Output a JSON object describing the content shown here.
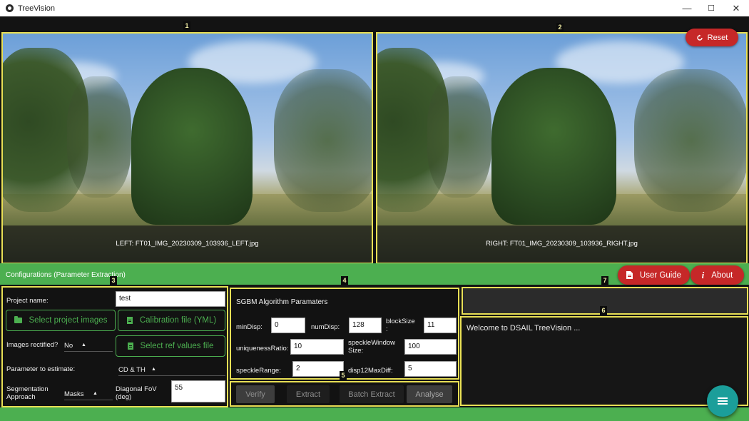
{
  "window": {
    "title": "TreeVision",
    "controls": {
      "minimize": "—",
      "maximize": "☐",
      "close": "✕"
    }
  },
  "markers": [
    "1",
    "2",
    "3",
    "4",
    "5",
    "6",
    "7"
  ],
  "images": {
    "left_caption": "LEFT: FT01_IMG_20230309_103936_LEFT.jpg",
    "right_caption": "RIGHT: FT01_IMG_20230309_103936_RIGHT.jpg"
  },
  "reset_label": "Reset",
  "band": {
    "title": "Configurations (Parameter Extraction)"
  },
  "header_buttons": {
    "user_guide": "User Guide",
    "about": "About"
  },
  "config": {
    "project_name_label": "Project name:",
    "project_name_value": "test",
    "select_images": "Select project images",
    "calibration_file": "Calibration file (YML)",
    "rectified_label": "Images rectified?",
    "rectified_value": "No",
    "select_ref": "Select ref values file",
    "param_label": "Parameter to estimate:",
    "param_value": "CD & TH",
    "segmentation_label_1": "Segmentation",
    "segmentation_label_2": "Approach",
    "segmentation_value": "Masks",
    "fov_label_1": "Diagonal FoV",
    "fov_label_2": "(deg)",
    "fov_value": "55"
  },
  "sgbm": {
    "title": "SGBM Algorithm Paramaters",
    "minDisp_label": "minDisp:",
    "minDisp": "0",
    "numDisp_label": "numDisp:",
    "numDisp": "128",
    "blockSize_label_1": "blockSize",
    "blockSize_label_2": ":",
    "blockSize": "11",
    "uniquenessRatio_label": "uniquenessRatio:",
    "uniquenessRatio": "10",
    "speckleWindow_label_1": "speckleWindow",
    "speckleWindow_label_2": "Size:",
    "speckleWindowSize": "100",
    "speckleRange_label": "speckleRange:",
    "speckleRange": "2",
    "disp12MaxDiff_label": "disp12MaxDiff:",
    "disp12MaxDiff": "5"
  },
  "actions": {
    "verify": "Verify",
    "extract": "Extract",
    "batch_extract": "Batch Extract",
    "analyse": "Analyse"
  },
  "log": {
    "text": "Welcome to DSAIL TreeVision ..."
  },
  "colors": {
    "accent_green": "#4caf50",
    "highlight_border": "#e8df55",
    "danger_red": "#c62828",
    "fab_teal": "#1b9e9a"
  },
  "icons": {
    "reset": "refresh-icon",
    "user_guide": "document-icon",
    "about": "info-icon",
    "fab": "menu-icon",
    "folder": "folder-icon",
    "file": "file-icon"
  }
}
